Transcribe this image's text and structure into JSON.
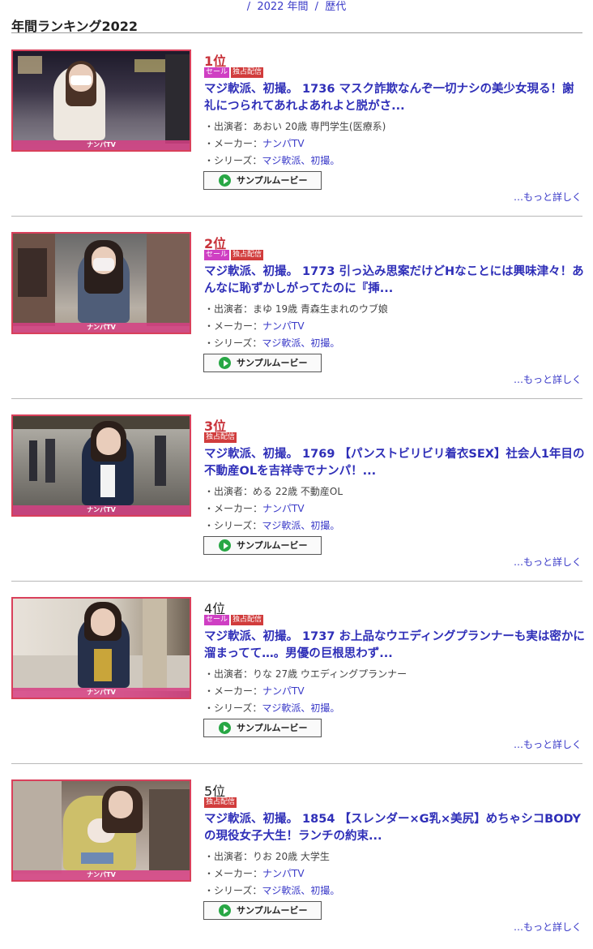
{
  "nav": {
    "sep1": "/",
    "year": "2022 年間",
    "sep2": "/",
    "history": "歴代"
  },
  "heading": "年間ランキング2022",
  "labels": {
    "sale_badge": "セール",
    "exclusive_badge": "独占配信",
    "performer_prefix": "・出演者：",
    "maker_prefix": "・メーカー：",
    "series_prefix": "・シリーズ：",
    "sample_button": "サンプルムービー",
    "more_link": "…もっと詳しく",
    "thumb_logo": "ナンパTV"
  },
  "items": [
    {
      "rank": "1位",
      "rank_style": "red",
      "sale": true,
      "exclusive": true,
      "title": "マジ軟派、初撮。 1736 マスク詐欺なんぞ一切ナシの美少女現る！謝礼につられてあれよあれよと脱がさ...",
      "performer": "あおい 20歳 専門学生(医療系)",
      "maker": "ナンパTV",
      "series": "マジ軟派、初撮。"
    },
    {
      "rank": "2位",
      "rank_style": "red",
      "sale": true,
      "exclusive": true,
      "title": "マジ軟派、初撮。 1773 引っ込み思案だけどHなことには興味津々！あんなに恥ずかしがってたのに『挿...",
      "performer": "まゆ 19歳 青森生まれのウブ娘",
      "maker": "ナンパTV",
      "series": "マジ軟派、初撮。"
    },
    {
      "rank": "3位",
      "rank_style": "red",
      "sale": false,
      "exclusive": true,
      "title": "マジ軟派、初撮。 1769 【パンストビリビリ着衣SEX】社会人1年目の不動産OLを吉祥寺でナンパ！...",
      "performer": "める 22歳 不動産OL",
      "maker": "ナンパTV",
      "series": "マジ軟派、初撮。"
    },
    {
      "rank": "4位",
      "rank_style": "black",
      "sale": true,
      "exclusive": true,
      "title": "マジ軟派、初撮。 1737 お上品なウエディングプランナーも実は密かに溜まってて…。男優の巨根思わず...",
      "performer": "りな 27歳 ウエディングプランナー",
      "maker": "ナンパTV",
      "series": "マジ軟派、初撮。"
    },
    {
      "rank": "5位",
      "rank_style": "black",
      "sale": false,
      "exclusive": true,
      "title": "マジ軟派、初撮。 1854 【スレンダー×G乳×美尻】めちゃシコBODYの現役女子大生！ランチの約束...",
      "performer": "りお 20歳 大学生",
      "maker": "ナンパTV",
      "series": "マジ軟派、初撮。"
    }
  ]
}
